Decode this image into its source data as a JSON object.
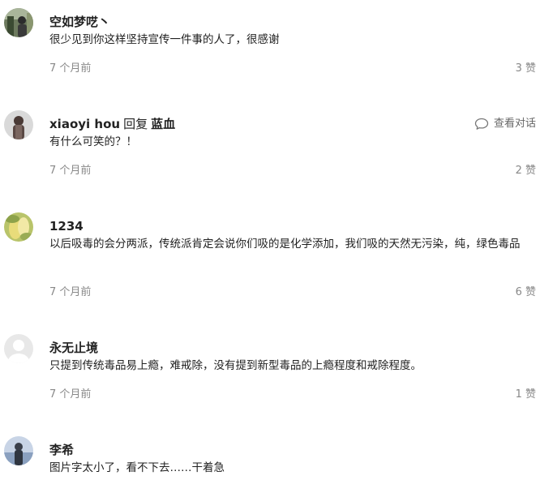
{
  "comments": [
    {
      "author": "空如梦呓丶",
      "text": "很少见到你这样坚持宣传一件事的人了，很感谢",
      "time": "7 个月前",
      "likes": "3 赞"
    },
    {
      "author": "xiaoyi hou",
      "reply_word": "回复",
      "reply_target": "蓝血",
      "conversation_label": "查看对话",
      "text": "有什么可笑的？！",
      "time": "7 个月前",
      "likes": "2 赞"
    },
    {
      "author": "1234",
      "text": "以后吸毒的会分两派，传统派肯定会说你们吸的是化学添加，我们吸的天然无污染，纯，绿色毒品",
      "time": "7 个月前",
      "likes": "6 赞"
    },
    {
      "author": "永无止境",
      "text": "只提到传统毒品易上瘾，难戒除，没有提到新型毒品的上瘾程度和戒除程度。",
      "time": "7 个月前",
      "likes": "1 赞"
    },
    {
      "author": "李希",
      "text": "图片字太小了，看不下去……干着急"
    }
  ],
  "icons": {
    "conversation": "speech-bubble-icon"
  }
}
